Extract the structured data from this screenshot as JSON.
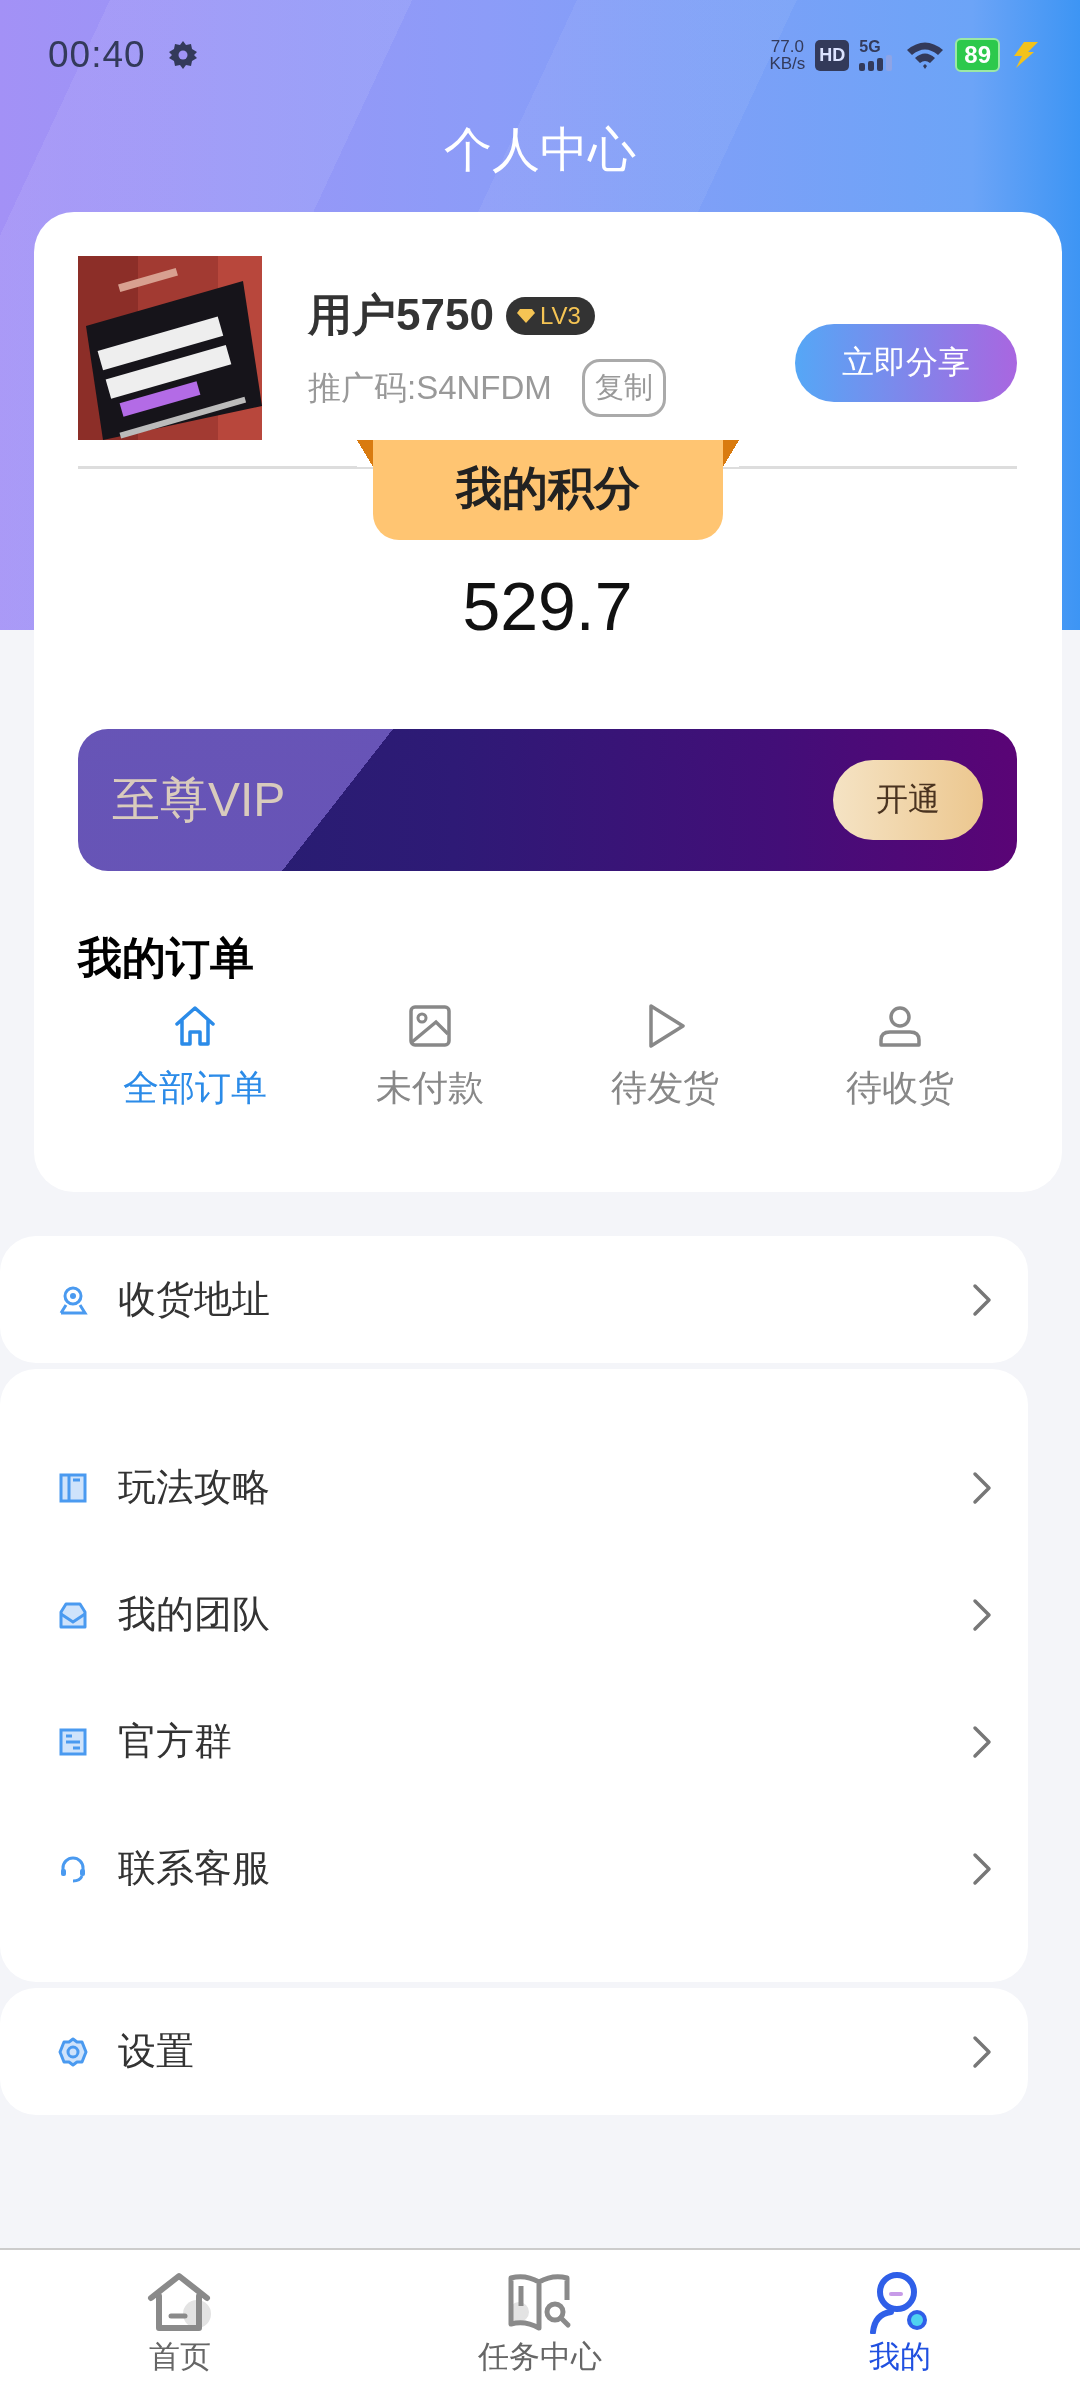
{
  "status_bar": {
    "time": "00:40",
    "net_speed": "77.0",
    "net_unit": "KB/s",
    "hd": "HD",
    "network": "5G",
    "battery": "89",
    "charging": true
  },
  "header": {
    "title": "个人中心"
  },
  "profile": {
    "username": "用户5750",
    "level": "LV3",
    "promo_code": "推广码:S4NFDM",
    "copy_button": "复制",
    "share_button": "立即分享"
  },
  "points": {
    "label": "我的积分",
    "value": "529.7"
  },
  "vip": {
    "title": "至尊VIP",
    "button": "开通"
  },
  "orders": {
    "title": "我的订单",
    "tabs": [
      {
        "label": "全部订单",
        "selected": true
      },
      {
        "label": "未付款",
        "selected": false
      },
      {
        "label": "待发货",
        "selected": false
      },
      {
        "label": "待收货",
        "selected": false
      }
    ]
  },
  "menu_groups": [
    [
      {
        "label": "收货地址"
      }
    ],
    [
      {
        "label": "玩法攻略"
      },
      {
        "label": "我的团队"
      },
      {
        "label": "官方群"
      },
      {
        "label": "联系客服"
      }
    ],
    [
      {
        "label": "设置"
      }
    ]
  ],
  "bottom_nav": [
    {
      "label": "首页",
      "selected": false
    },
    {
      "label": "任务中心",
      "selected": false
    },
    {
      "label": "我的",
      "selected": true
    }
  ]
}
